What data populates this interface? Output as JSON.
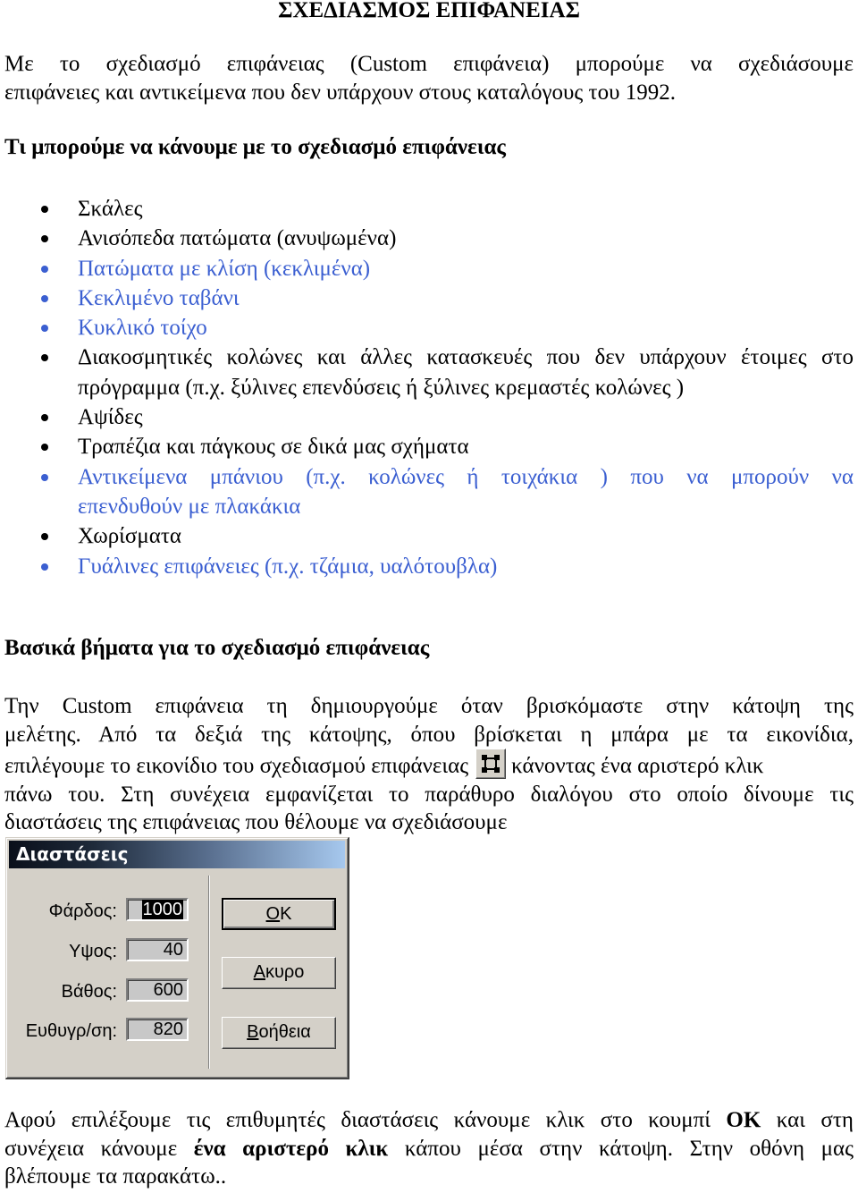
{
  "title": "ΣΧΕΔΙΑΣΜΟΣ ΕΠΙΦΑΝΕΙΑΣ",
  "intro": {
    "lines": [
      "Με το σχεδιασμό επιφάνειας (Custom επιφάνεια) μπορούμε να σχεδιάσουμε",
      "επιφάνειες και αντικείμενα που δεν υπάρχουν στους καταλόγους του 1992."
    ]
  },
  "section1": {
    "heading": "Τι μπορούμε να κάνουμε με το σχεδιασμό επιφάνειας",
    "items": [
      {
        "text": "Σκάλες",
        "color": "black"
      },
      {
        "text": "Ανισόπεδα πατώματα (ανυψωμένα)",
        "color": "black"
      },
      {
        "text": "Πατώματα με κλίση (κεκλιμένα)",
        "color": "blue"
      },
      {
        "text": "Κεκλιμένο ταβάνι",
        "color": "blue"
      },
      {
        "text": "Κυκλικό τοίχο",
        "color": "blue"
      },
      {
        "text": "Διακοσμητικές κολώνες και άλλες κατασκευές που δεν υπάρχουν έτοιμες στο",
        "text2": "πρόγραμμα (π.χ. ξύλινες επενδύσεις ή ξύλινες κρεμαστές κολώνες )",
        "color": "black"
      },
      {
        "text": "Αψίδες",
        "color": "black"
      },
      {
        "text": "Τραπέζια και πάγκους σε δικά μας σχήματα",
        "color": "black"
      },
      {
        "text": "Αντικείμενα μπάνιου (π.χ. κολώνες ή τοιχάκια ) που να μπορούν να",
        "text2": "επενδυθούν με πλακάκια",
        "color": "blue"
      },
      {
        "text": "Χωρίσματα",
        "color": "black"
      },
      {
        "text": "Γυάλινες επιφάνειες (π.χ. τζάμια, υαλότουβλα)",
        "color": "blue"
      }
    ]
  },
  "section2": {
    "heading": "Βασικά βήματα για το σχεδιασμό επιφάνειας",
    "lines": [
      "Την Custom επιφάνεια τη δημιουργούμε όταν βρισκόμαστε στην κάτοψη της",
      "μελέτης. Από τα δεξιά της κάτοψης, όπου βρίσκεται η μπάρα με τα εικονίδια,",
      "επιλέγουμε το εικονίδιο του σχεδιασμού επιφάνειας",
      "κάνοντας ένα αριστερό κλικ",
      "πάνω του. Στη συνέχεια εμφανίζεται το παράθυρο διαλόγου στο οποίο δίνουμε τις",
      "διαστάσεις της επιφάνειας που θέλουμε να σχεδιάσουμε"
    ],
    "icon": "custom-surface-icon"
  },
  "dialog": {
    "title": "Διαστάσεις",
    "fields": [
      {
        "label": "Φάρδος:",
        "value": "1000",
        "selected": true
      },
      {
        "label": "Υψος:",
        "value": "40"
      },
      {
        "label": "Βάθος:",
        "value": "600"
      },
      {
        "label": "Ευθυγρ/ση:",
        "value": "820"
      }
    ],
    "buttons": {
      "ok_accel": "O",
      "ok_rest": "K",
      "cancel_accel": "Α",
      "cancel_rest": "κυρο",
      "help_accel": "Β",
      "help_rest": "οήθεια"
    }
  },
  "outro": {
    "l1a": "Αφού επιλέξουμε τις επιθυμητές διαστάσεις κάνουμε κλικ στο κουμπί ",
    "l1b": "ΟΚ",
    "l1c": " και στη",
    "l2a": "συνέχεια κάνουμε ",
    "l2b": "ένα αριστερό κλικ",
    "l2c": " κάπου μέσα στην κάτοψη. Στην οθόνη μας",
    "l3": "βλέπουμε τα παρακάτω.."
  },
  "colors": {
    "blue_text": "#3b5fd1",
    "dialog_bg": "#d4d0c8"
  }
}
